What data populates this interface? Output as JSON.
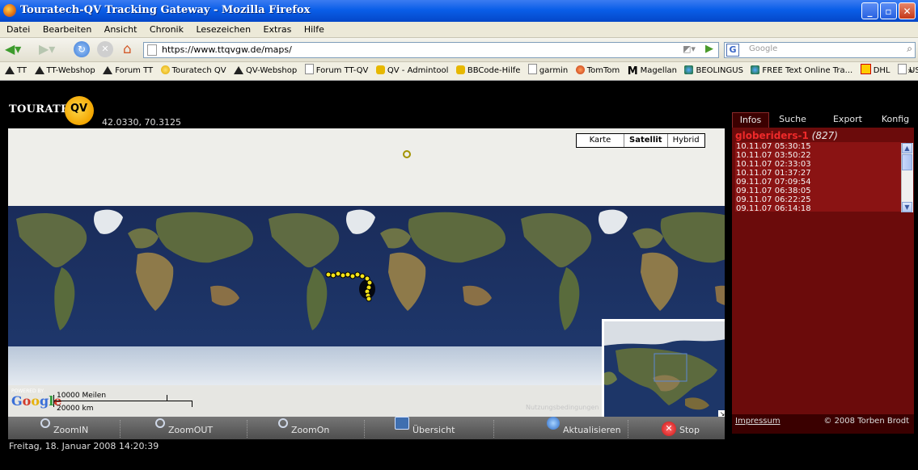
{
  "window": {
    "title": "Touratech-QV Tracking Gateway - Mozilla Firefox",
    "min_glyph": "_",
    "max_glyph": "▫",
    "close_glyph": "✕"
  },
  "menu": [
    "Datei",
    "Bearbeiten",
    "Ansicht",
    "Chronik",
    "Lesezeichen",
    "Extras",
    "Hilfe"
  ],
  "nav": {
    "url": "https://www.ttqvgw.de/maps/",
    "search_placeholder": "Google",
    "search_engine_glyph": "G"
  },
  "bookmarks": [
    {
      "label": "TT",
      "icon": "tt-icon"
    },
    {
      "label": "TT-Webshop",
      "icon": "tt-icon"
    },
    {
      "label": "Forum TT",
      "icon": "tt-icon"
    },
    {
      "label": "Touratech QV",
      "icon": "sun-icon"
    },
    {
      "label": "QV-Webshop",
      "icon": "tt-icon"
    },
    {
      "label": "Forum TT-QV",
      "icon": "page-icon"
    },
    {
      "label": "QV - Admintool",
      "icon": "qv-icon"
    },
    {
      "label": "BBCode-Hilfe",
      "icon": "qv-icon"
    },
    {
      "label": "garmin",
      "icon": "page-icon"
    },
    {
      "label": "TomTom",
      "icon": "ball-icon"
    },
    {
      "label": "Magellan",
      "icon": "m-icon"
    },
    {
      "label": "BEOLINGUS",
      "icon": "people-icon"
    },
    {
      "label": "FREE Text Online Tra...",
      "icon": "people-icon"
    },
    {
      "label": "DHL",
      "icon": "dhl-icon"
    },
    {
      "label": "USt-Id Nr.",
      "icon": "page-icon"
    }
  ],
  "bookmarks_more": "»",
  "app": {
    "logo_word": "TOURATECH",
    "logo_qv": "QV",
    "coords": "42.0330, 70.3125",
    "datetime": "Freitag, 18. Januar 2008 14:20:39"
  },
  "map": {
    "types": [
      "Karte",
      "Satellit",
      "Hybrid"
    ],
    "selected": "Satellit",
    "powered_by": "POWERED BY",
    "google": [
      "G",
      "o",
      "o",
      "g",
      "l",
      "e"
    ],
    "scale_miles": "10000 Meilen",
    "scale_km": "20000 km",
    "terms": "Nutzungsbedingungen",
    "corner_glyph": "↘"
  },
  "toolbar": {
    "buttons": [
      "ZoomIN",
      "ZoomOUT",
      "ZoomOn",
      "Übersicht",
      "Aktualisieren",
      "Stop"
    ],
    "stop_glyph": "✕"
  },
  "panel": {
    "tabs": [
      "Infos",
      "Suche",
      "Export",
      "Konfig"
    ],
    "active_tab": "Infos",
    "user": "globeriders-1",
    "count": "(827)",
    "entries": [
      "10.11.07 05:30:15",
      "10.11.07 03:50:22",
      "10.11.07 02:33:03",
      "10.11.07 01:37:27",
      "09.11.07 07:09:54",
      "09.11.07 06:38:05",
      "09.11.07 06:22:25",
      "09.11.07 06:14:18"
    ],
    "impressum": "Impressum",
    "copyright": "© 2008 Torben Brodt",
    "scroll_up": "▲",
    "scroll_down": "▼"
  },
  "colors": {
    "panel_bg": "#6b0b0b",
    "list_bg": "#8a1313",
    "track_dot": "#f5e418",
    "ocean": "#1c2f5e"
  }
}
